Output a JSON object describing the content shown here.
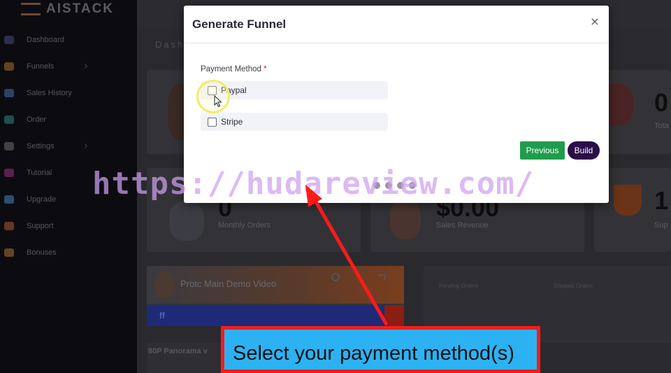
{
  "app": {
    "logo_text": "AISTACK",
    "sidebar_items": [
      {
        "label": "Dashboard",
        "icon": "dashboard-icon",
        "color": "#3a3a6a",
        "caret": false
      },
      {
        "label": "Funnels",
        "icon": "funnel-icon",
        "color": "#8a5a20",
        "caret": true
      },
      {
        "label": "Sales History",
        "icon": "sales-history-icon",
        "color": "#3a5a8a",
        "caret": false
      },
      {
        "label": "Order",
        "icon": "order-icon",
        "color": "#2a6a6a",
        "caret": false
      },
      {
        "label": "Settings",
        "icon": "settings-icon",
        "color": "#5a5a5a",
        "caret": true
      },
      {
        "label": "Tutorial",
        "icon": "tutorial-icon",
        "color": "#7a2a6a",
        "caret": false
      },
      {
        "label": "Upgrade",
        "icon": "upgrade-icon",
        "color": "#3a6a9a",
        "caret": false
      },
      {
        "label": "Support",
        "icon": "support-icon",
        "color": "#8a4a2a",
        "caret": false
      },
      {
        "label": "Bonuses",
        "icon": "bonuses-icon",
        "color": "#8a5a2a",
        "caret": false
      }
    ],
    "dashboard_heading": "Dash",
    "cards": {
      "monthly_orders_value": "0",
      "monthly_orders_label": "Monthly Orders",
      "sales_revenue_value": "$0.00",
      "sales_revenue_label": "Sales Revenue",
      "right_top_value": "0",
      "right_top_label": "Tota",
      "right_bottom_value": "1",
      "right_bottom_label": "Sup"
    },
    "video": {
      "title": "Protc Main Demo Video",
      "bar_text": "ff"
    },
    "video2_title": "80P Panorama v",
    "orders_panel": {
      "pending_label": "Pending Orders",
      "shipped_label": "Shipped Orders"
    }
  },
  "modal": {
    "title": "Generate Funnel",
    "close_label": "×",
    "field_label": "Payment Method",
    "required_mark": "*",
    "options": [
      {
        "label": "Paypal",
        "checked": false
      },
      {
        "label": "Stripe",
        "checked": false
      }
    ],
    "previous_label": "Previous",
    "build_label": "Build",
    "colors": {
      "previous": "#1f9d4c",
      "build": "#2c0c4a"
    }
  },
  "overlay": {
    "watermark": "https://hudareview.com/",
    "caption": "Select your payment method(s)",
    "arrow_color": "#ff1a1a"
  }
}
